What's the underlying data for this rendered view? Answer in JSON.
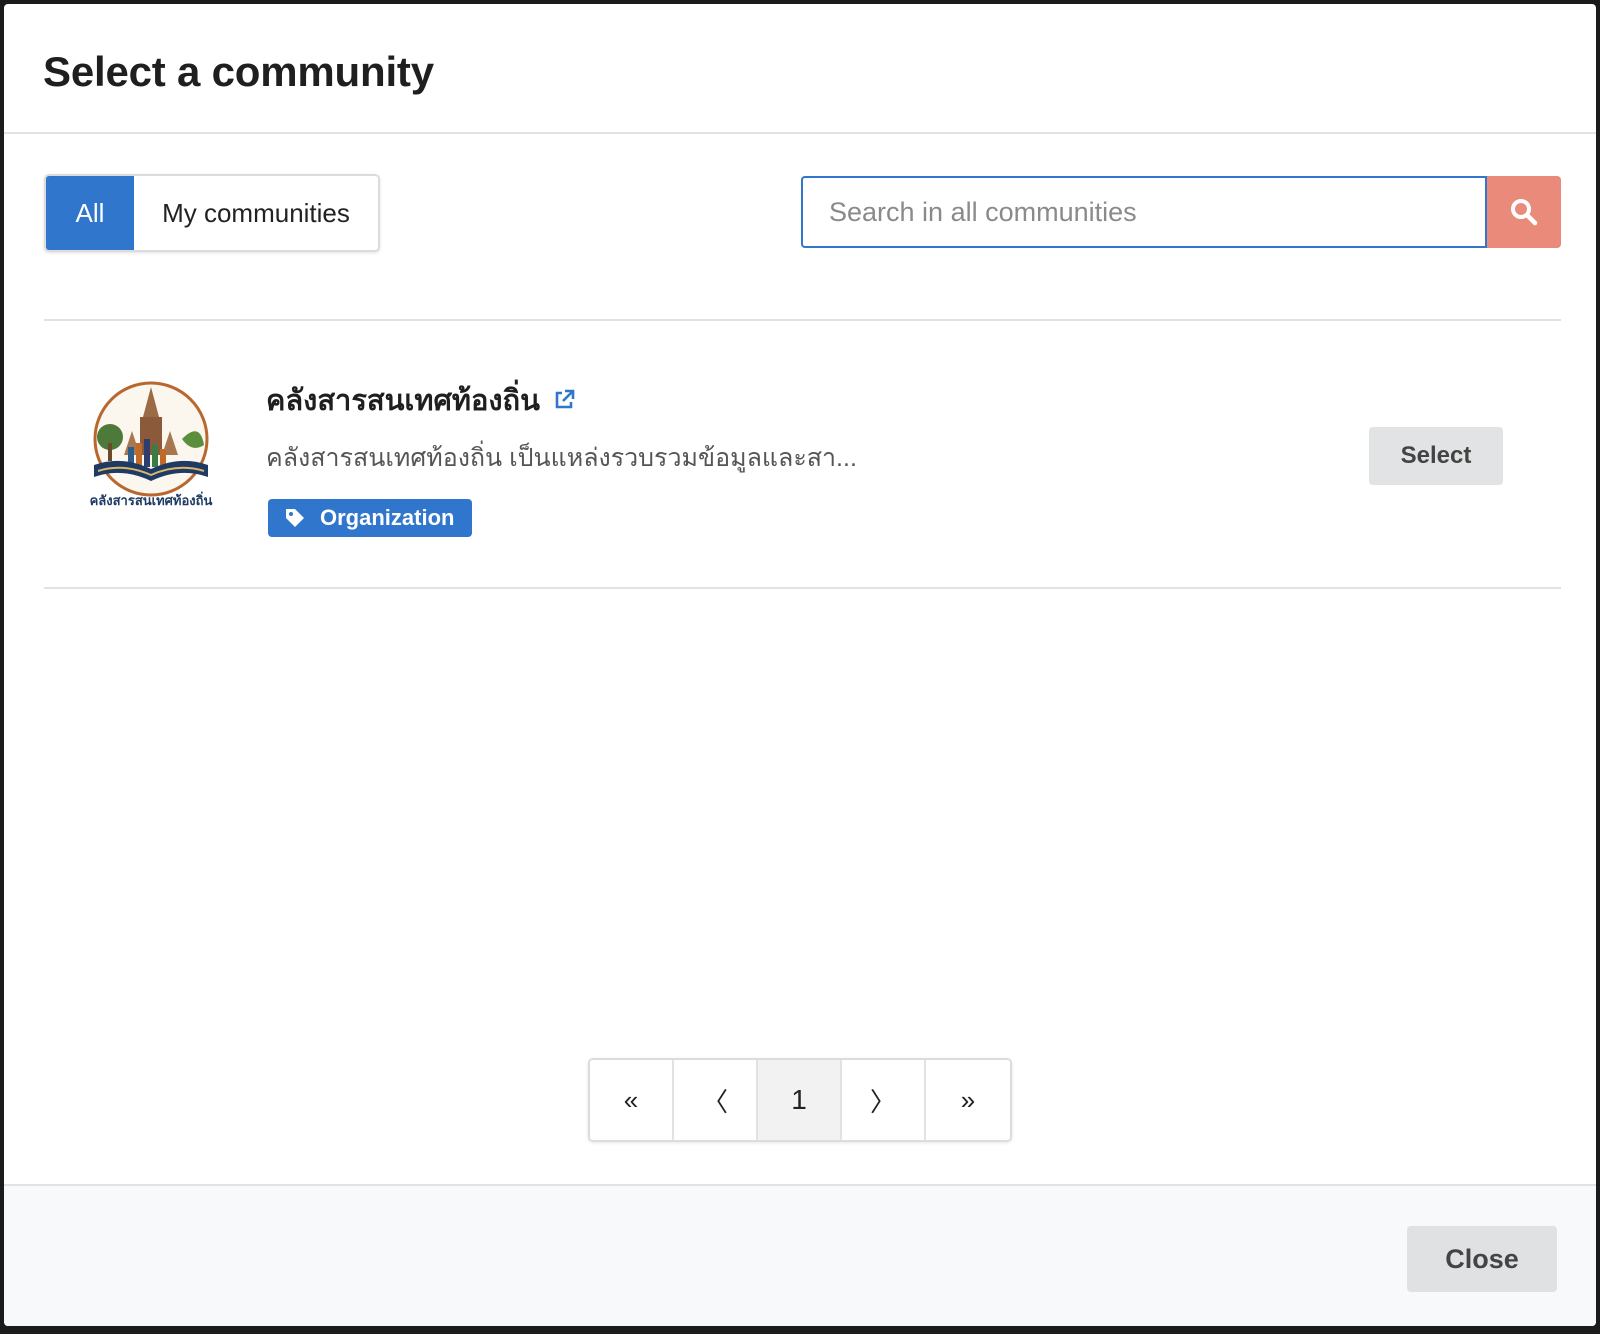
{
  "modal": {
    "title": "Select a community"
  },
  "filters": {
    "all_label": "All",
    "mine_label": "My communities",
    "active": "All"
  },
  "search": {
    "placeholder": "Search in all communities",
    "value": ""
  },
  "communities": [
    {
      "name": "คลังสารสนเทศท้องถิ่น",
      "description": "คลังสารสนเทศท้องถิ่น เป็นแหล่งรวบรวมข้อมูลและสา...",
      "logo_caption": "คลังสารสนเทศท้องถิ่น",
      "tag": "Organization",
      "select_label": "Select"
    }
  ],
  "pagination": {
    "first": "«",
    "prev": "〈",
    "current": "1",
    "next": "〉",
    "last": "»"
  },
  "footer": {
    "close_label": "Close"
  },
  "colors": {
    "primary": "#2f76cc",
    "search_button": "#ea8a7a",
    "neutral_button": "#e2e3e4"
  }
}
